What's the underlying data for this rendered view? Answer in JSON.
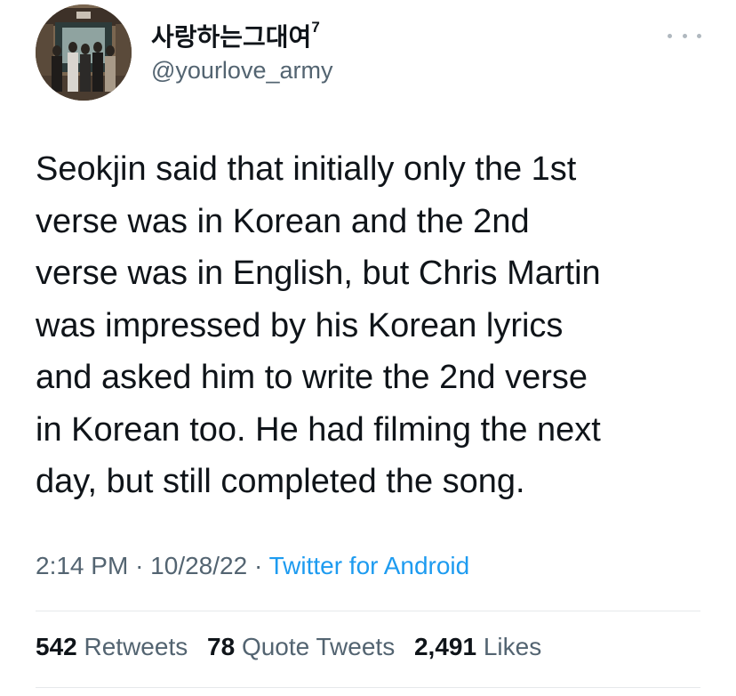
{
  "user": {
    "display_name": "사랑하는그대여",
    "name_superscript": "7",
    "handle": "@yourlove_army",
    "avatar_icon": "profile-photo"
  },
  "tweet": {
    "text_lines": [
      "Seokjin said that initially only the 1st",
      "verse was in Korean and the 2nd",
      "verse was in English, but Chris Martin",
      "was impressed by his Korean lyrics",
      "and asked him to write the 2nd verse",
      "in Korean too. He had filming the next",
      "day, but still completed the song."
    ],
    "time": "2:14 PM",
    "date": "10/28/22",
    "separator": "·",
    "source": "Twitter for Android"
  },
  "stats": {
    "retweets_count": "542",
    "retweets_label": "Retweets",
    "quotes_count": "78",
    "quotes_label": "Quote Tweets",
    "likes_count": "2,491",
    "likes_label": "Likes"
  },
  "colors": {
    "text": "#0f1419",
    "secondary": "#536471",
    "link": "#1d9bf0",
    "divider": "#e6e9eb"
  },
  "icons": {
    "more": "more-horizontal-icon"
  }
}
